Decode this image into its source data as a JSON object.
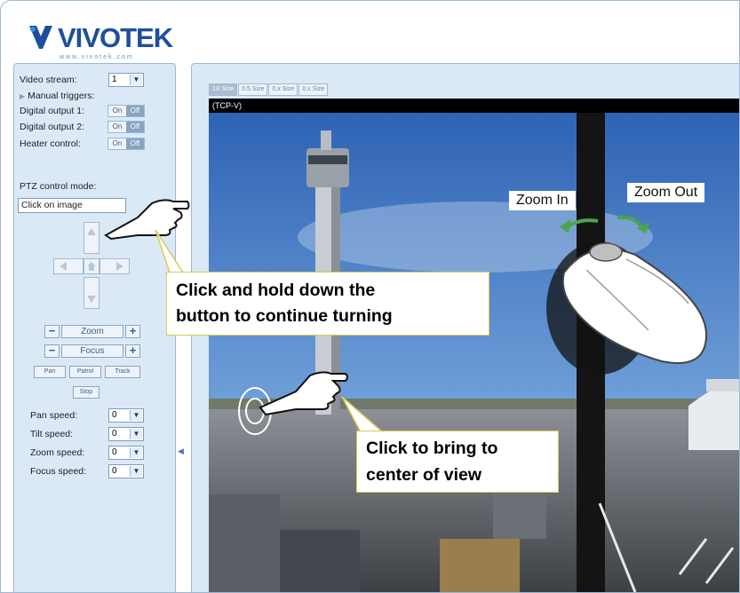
{
  "brand": {
    "name": "VIVOTEK",
    "tagline": "www.vivotek.com"
  },
  "sidebar": {
    "video_stream_label": "Video stream:",
    "video_stream_value": "1",
    "manual_triggers_label": "Manual triggers:",
    "digital_output_1_label": "Digital output 1:",
    "digital_output_2_label": "Digital output 2:",
    "heater_control_label": "Heater control:",
    "on_label": "On",
    "off_label": "Off",
    "ptz_mode_label": "PTZ control mode:",
    "ptz_mode_value": "Click on image",
    "zoom_label": "Zoom",
    "focus_label": "Focus",
    "pan_label": "Pan",
    "patrol_label": "Patrol",
    "track_label": "Track",
    "stop_label": "Stop",
    "pan_speed_label": "Pan speed:",
    "tilt_speed_label": "Tilt speed:",
    "zoom_speed_label": "Zoom speed:",
    "focus_speed_label": "Focus speed:",
    "pan_speed_value": "0",
    "tilt_speed_value": "0",
    "zoom_speed_value": "0",
    "focus_speed_value": "0",
    "minus": "−",
    "plus": "+"
  },
  "main": {
    "zoom_tabs": [
      "1X Size",
      "0.5 Size",
      "0.x Size",
      "0.x Size"
    ],
    "stream_overlay": "(TCP-V)"
  },
  "callouts": {
    "hold_line1": "Click and hold down the",
    "hold_line2": "button to continue turning",
    "center_line1": "Click to bring to",
    "center_line2": "center of view",
    "zoom_in": "Zoom In",
    "zoom_out": "Zoom Out"
  },
  "colors": {
    "brand": "#1d4fa0",
    "panel": "#dbe9f7",
    "callout_border": "#d9c95a"
  }
}
